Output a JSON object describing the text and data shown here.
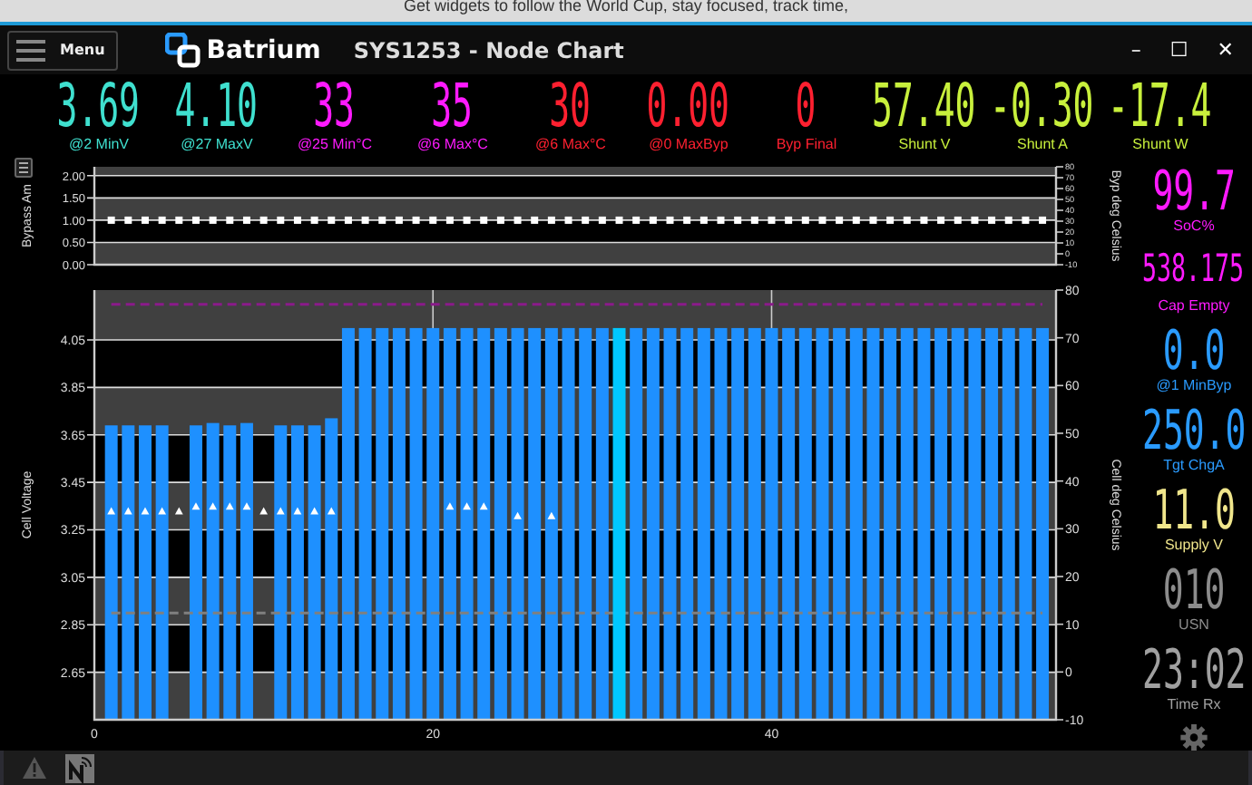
{
  "browser_banner": "Get widgets to follow the World Cup, stay focused, track time,",
  "window": {
    "menu_label": "Menu",
    "logo_text": "Batrium",
    "title": "SYS1253 - Node Chart",
    "controls": [
      "–",
      "☐",
      "✕"
    ]
  },
  "top_gauges": [
    {
      "value": "3.69",
      "label": "@2 MinV",
      "color": "#3fe0cf"
    },
    {
      "value": "4.10",
      "label": "@27 MaxV",
      "color": "#3fe0cf"
    },
    {
      "value": "33",
      "label": "@25 Min°C",
      "color": "#ff1aff"
    },
    {
      "value": "35",
      "label": "@6 Max°C",
      "color": "#ff1aff"
    },
    {
      "value": "30",
      "label": "@6 Max°C",
      "color": "#ff2030"
    },
    {
      "value": "0.00",
      "label": "@0 MaxByp",
      "color": "#ff2030"
    },
    {
      "value": "0",
      "label": "Byp Final",
      "color": "#ff2030"
    },
    {
      "value": "57.40",
      "label": "Shunt V",
      "color": "#c8f03c"
    },
    {
      "value": "-0.30",
      "label": "Shunt A",
      "color": "#c8f03c"
    },
    {
      "value": "-17.4",
      "label": "Shunt W",
      "color": "#c8f03c"
    }
  ],
  "bypass_chart": {
    "y2label": "Byp deg Celsius",
    "y2ticks": [
      "80",
      "70",
      "60",
      "50",
      "40",
      "30",
      "20",
      "10",
      "0",
      "-10"
    ],
    "chart_data": {
      "type": "scatter",
      "ylabel": "Bypass Am",
      "x": [
        1,
        2,
        3,
        4,
        5,
        6,
        7,
        8,
        9,
        10,
        11,
        12,
        13,
        14,
        15,
        16,
        17,
        18,
        19,
        20,
        21,
        22,
        23,
        24,
        25,
        26,
        27,
        28,
        29,
        30,
        31,
        32,
        33,
        34,
        35,
        36,
        37,
        38,
        39,
        40,
        41,
        42,
        43,
        44,
        45,
        46,
        47,
        48,
        49,
        50,
        51,
        52,
        53,
        54,
        55,
        56
      ],
      "series": [
        {
          "color": "#ffffff",
          "values": [
            1,
            1,
            1,
            1,
            1,
            1,
            1,
            1,
            1,
            1,
            1,
            1,
            1,
            1,
            1,
            1,
            1,
            1,
            1,
            1,
            1,
            1,
            1,
            1,
            1,
            1,
            1,
            1,
            1,
            1,
            1,
            1,
            1,
            1,
            1,
            1,
            1,
            1,
            1,
            1,
            1,
            1,
            1,
            1,
            1,
            1,
            1,
            1,
            1,
            1,
            1,
            1,
            1,
            1,
            1,
            1
          ]
        }
      ],
      "xlim": [
        0,
        56.8
      ],
      "ylim": [
        0,
        2.2
      ],
      "grid": true,
      "yticks": [
        {
          "value": 0,
          "label": "0.00"
        },
        {
          "value": 0.5,
          "label": "0.50"
        },
        {
          "value": 1,
          "label": "1.00"
        },
        {
          "value": 1.5,
          "label": "1.50"
        },
        {
          "value": 2,
          "label": "2.00"
        }
      ]
    }
  },
  "cell_chart": {
    "y2label": "Cell deg Celsius",
    "y2ticks": [
      "80",
      "70",
      "60",
      "50",
      "40",
      "30",
      "20",
      "10",
      "0",
      "-10"
    ],
    "chart_data": {
      "type": "bar",
      "ylabel": "Cell Voltage",
      "grid": true,
      "x": [
        1,
        2,
        3,
        4,
        5,
        6,
        7,
        8,
        9,
        10,
        11,
        12,
        13,
        14,
        15,
        16,
        17,
        18,
        19,
        20,
        21,
        22,
        23,
        24,
        25,
        26,
        27,
        28,
        29,
        30,
        31,
        32,
        33,
        34,
        35,
        36,
        37,
        38,
        39,
        40,
        41,
        42,
        43,
        44,
        45,
        46,
        47,
        48,
        49,
        50,
        51,
        52,
        53,
        54,
        55,
        56
      ],
      "series": [
        {
          "color": "#1e90ff",
          "values": [
            3.69,
            3.69,
            3.69,
            3.69,
            null,
            3.69,
            3.7,
            3.69,
            3.7,
            null,
            3.69,
            3.69,
            3.69,
            3.72,
            4.1,
            4.1,
            4.1,
            4.1,
            4.1,
            4.1,
            4.1,
            4.1,
            4.1,
            4.1,
            4.1,
            4.1,
            4.1,
            4.1,
            4.1,
            4.1,
            null,
            4.1,
            4.1,
            4.1,
            4.1,
            4.1,
            4.1,
            4.1,
            4.1,
            4.1,
            4.1,
            4.1,
            4.1,
            4.1,
            4.1,
            4.1,
            4.1,
            4.1,
            4.1,
            4.1,
            4.1,
            4.1,
            4.1,
            4.1,
            4.1,
            4.1
          ]
        },
        {
          "type": "line",
          "line_style": "dashed",
          "color": "#8a1a8a",
          "values": [
            4.2,
            4.2,
            4.2,
            4.2,
            4.2,
            4.2,
            4.2,
            4.2,
            4.2,
            4.2,
            4.2,
            4.2,
            4.2,
            4.2,
            4.2,
            4.2,
            4.2,
            4.2,
            4.2,
            4.2,
            4.2,
            4.2,
            4.2,
            4.2,
            4.2,
            4.2,
            4.2,
            4.2,
            4.2,
            4.2,
            4.2,
            4.2,
            4.2,
            4.2,
            4.2,
            4.2,
            4.2,
            4.2,
            4.2,
            4.2,
            4.2,
            4.2,
            4.2,
            4.2,
            4.2,
            4.2,
            4.2,
            4.2,
            4.2,
            4.2,
            4.2,
            4.2,
            4.2,
            4.2,
            4.2,
            4.2
          ]
        },
        {
          "type": "line",
          "line_style": "dashed",
          "color": "#808080",
          "values": [
            2.9,
            2.9,
            2.9,
            2.9,
            2.9,
            2.9,
            2.9,
            2.9,
            2.9,
            2.9,
            2.9,
            2.9,
            2.9,
            2.9,
            2.9,
            2.9,
            2.9,
            2.9,
            2.9,
            2.9,
            2.9,
            2.9,
            2.9,
            2.9,
            2.9,
            2.9,
            2.9,
            2.9,
            2.9,
            2.9,
            2.9,
            2.9,
            2.9,
            2.9,
            2.9,
            2.9,
            2.9,
            2.9,
            2.9,
            2.9,
            2.9,
            2.9,
            2.9,
            2.9,
            2.9,
            2.9,
            2.9,
            2.9,
            2.9,
            2.9,
            2.9,
            2.9,
            2.9,
            2.9,
            2.9,
            2.9
          ]
        },
        {
          "type": "bar",
          "color": "#00c8ff",
          "values": [
            null,
            null,
            null,
            null,
            null,
            null,
            null,
            null,
            null,
            null,
            null,
            null,
            null,
            null,
            null,
            null,
            null,
            null,
            null,
            null,
            null,
            null,
            null,
            null,
            null,
            null,
            null,
            null,
            null,
            null,
            4.1,
            null,
            null,
            null,
            null,
            null,
            null,
            null,
            null,
            null,
            null,
            null,
            null,
            null,
            null,
            null,
            null,
            null,
            null,
            null,
            null,
            null,
            null,
            null,
            null,
            null
          ]
        },
        {
          "type": "scatter",
          "color": "#ffffff",
          "values": [
            3.33,
            3.33,
            3.33,
            3.33,
            3.33,
            3.35,
            3.35,
            3.35,
            3.35,
            3.33,
            3.33,
            3.33,
            3.33,
            3.33,
            null,
            null,
            null,
            null,
            null,
            null,
            3.35,
            3.35,
            3.35,
            null,
            3.31,
            null,
            3.31,
            null,
            null,
            null,
            null,
            null,
            null,
            null,
            null,
            null,
            null,
            null,
            null,
            null,
            null,
            null,
            null,
            null,
            null,
            null,
            null,
            null,
            null,
            null,
            null,
            null,
            null,
            null,
            null,
            null
          ]
        }
      ],
      "xlim": [
        0,
        56.8
      ],
      "ylim": [
        2.45,
        4.26
      ],
      "xticks": [
        0,
        20,
        40
      ],
      "yticks": [
        {
          "value": 2.65,
          "label": "2.65"
        },
        {
          "value": 2.85,
          "label": "2.85"
        },
        {
          "value": 3.05,
          "label": "3.05"
        },
        {
          "value": 3.25,
          "label": "3.25"
        },
        {
          "value": 3.45,
          "label": "3.45"
        },
        {
          "value": 3.65,
          "label": "3.65"
        },
        {
          "value": 3.85,
          "label": "3.85"
        },
        {
          "value": 4.05,
          "label": "4.05"
        }
      ]
    }
  },
  "side_gauges": [
    {
      "value": "99.7",
      "label": "SoC%",
      "color": "#ff1aff"
    },
    {
      "value": "538.175",
      "label": "Cap Empty",
      "color": "#ff1aff"
    },
    {
      "value": "0.0",
      "label": "@1 MinByp",
      "color": "#2a9bff"
    },
    {
      "value": "250.0",
      "label": "Tgt ChgA",
      "color": "#2a9bff"
    },
    {
      "value": "11.0",
      "label": "Supply V",
      "color": "#f0e68c"
    },
    {
      "value": "010",
      "label": "USN",
      "color": "#8c8c8c"
    },
    {
      "value": "23:02",
      "label": "Time Rx",
      "color": "#a0a0a0"
    }
  ]
}
